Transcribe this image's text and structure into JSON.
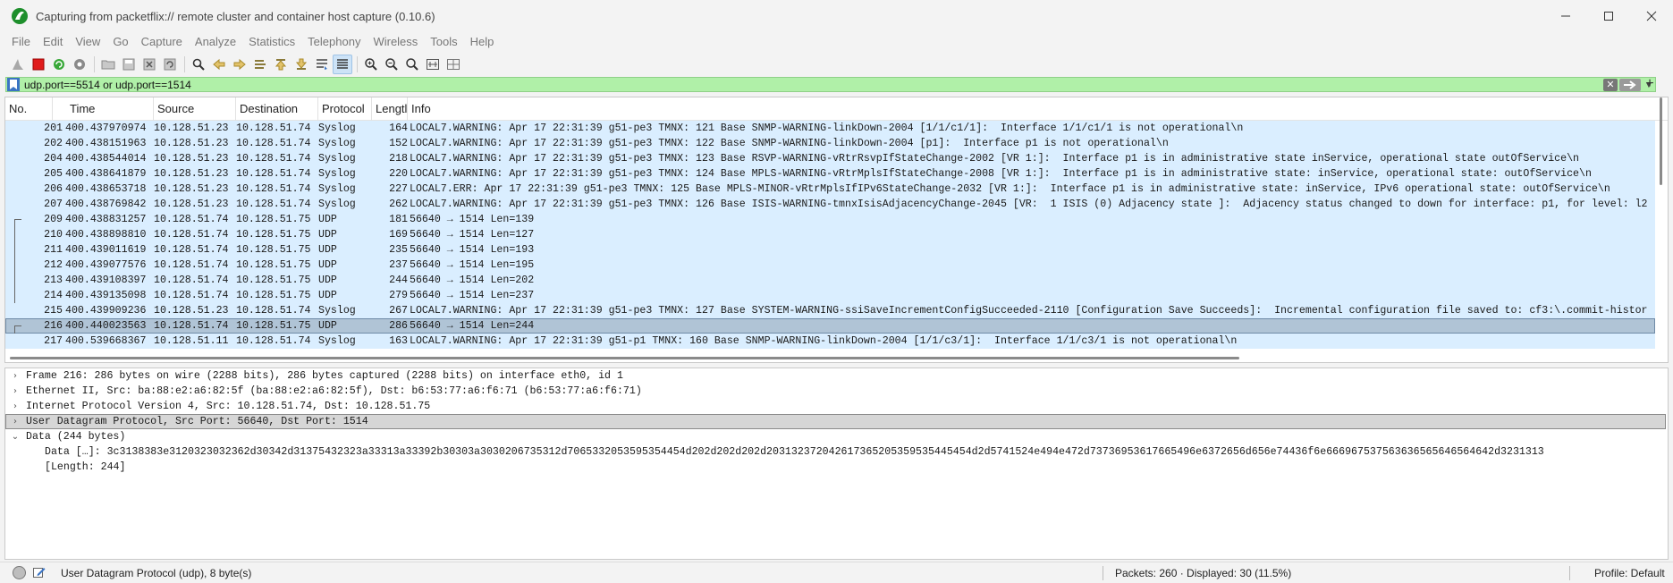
{
  "window": {
    "title": "Capturing from packetflix:// remote cluster and container host capture (0.10.6)",
    "minimize_icon": "minimize-icon",
    "maximize_icon": "maximize-icon",
    "close_icon": "close-icon"
  },
  "menu": [
    "File",
    "Edit",
    "View",
    "Go",
    "Capture",
    "Analyze",
    "Statistics",
    "Telephony",
    "Wireless",
    "Tools",
    "Help"
  ],
  "toolbar": {
    "icons": [
      "shark-fin-start-icon",
      "stop-capture-icon",
      "restart-capture-icon",
      "capture-options-icon",
      "open-file-icon",
      "save-file-icon",
      "close-file-icon",
      "reload-file-icon",
      "find-packet-icon",
      "go-back-icon",
      "go-forward-icon",
      "go-to-packet-icon",
      "go-first-packet-icon",
      "go-last-packet-icon",
      "auto-scroll-icon",
      "colorize-icon",
      "zoom-in-icon",
      "zoom-out-icon",
      "normal-size-icon",
      "resize-columns-icon",
      "layout-icon"
    ]
  },
  "filter": {
    "value": "udp.port==5514 or udp.port==1514",
    "clear_label": "✕",
    "add_label": "+",
    "accent_color": "#b0f0a8"
  },
  "packet_list": {
    "columns": [
      "No.",
      "Time",
      "Source",
      "Destination",
      "Protocol",
      "Lengtl",
      "Info"
    ],
    "rows": [
      {
        "no": "201",
        "time": "400.437970974",
        "src": "10.128.51.23",
        "dst": "10.128.51.74",
        "proto": "Syslog",
        "len": "164",
        "info": "LOCAL7.WARNING: Apr 17 22:31:39 g51-pe3 TMNX: 121 Base SNMP-WARNING-linkDown-2004 [1/1/c1/1]:  Interface 1/1/c1/1 is not operational\\n"
      },
      {
        "no": "202",
        "time": "400.438151963",
        "src": "10.128.51.23",
        "dst": "10.128.51.74",
        "proto": "Syslog",
        "len": "152",
        "info": "LOCAL7.WARNING: Apr 17 22:31:39 g51-pe3 TMNX: 122 Base SNMP-WARNING-linkDown-2004 [p1]:  Interface p1 is not operational\\n"
      },
      {
        "no": "204",
        "time": "400.438544014",
        "src": "10.128.51.23",
        "dst": "10.128.51.74",
        "proto": "Syslog",
        "len": "218",
        "info": "LOCAL7.WARNING: Apr 17 22:31:39 g51-pe3 TMNX: 123 Base RSVP-WARNING-vRtrRsvpIfStateChange-2002 [VR 1:]:  Interface p1 is in administrative state inService, operational state outOfService\\n"
      },
      {
        "no": "205",
        "time": "400.438641879",
        "src": "10.128.51.23",
        "dst": "10.128.51.74",
        "proto": "Syslog",
        "len": "220",
        "info": "LOCAL7.WARNING: Apr 17 22:31:39 g51-pe3 TMNX: 124 Base MPLS-WARNING-vRtrMplsIfStateChange-2008 [VR 1:]:  Interface p1 is in administrative state: inService, operational state: outOfService\\n"
      },
      {
        "no": "206",
        "time": "400.438653718",
        "src": "10.128.51.23",
        "dst": "10.128.51.74",
        "proto": "Syslog",
        "len": "227",
        "info": "LOCAL7.ERR: Apr 17 22:31:39 g51-pe3 TMNX: 125 Base MPLS-MINOR-vRtrMplsIfIPv6StateChange-2032 [VR 1:]:  Interface p1 is in administrative state: inService, IPv6 operational state: outOfService\\n"
      },
      {
        "no": "207",
        "time": "400.438769842",
        "src": "10.128.51.23",
        "dst": "10.128.51.74",
        "proto": "Syslog",
        "len": "262",
        "info": "LOCAL7.WARNING: Apr 17 22:31:39 g51-pe3 TMNX: 126 Base ISIS-WARNING-tmnxIsisAdjacencyChange-2045 [VR:  1 ISIS (0) Adjacency state ]:  Adjacency status changed to down for interface: p1, for level: l2"
      },
      {
        "no": "209",
        "time": "400.438831257",
        "src": "10.128.51.74",
        "dst": "10.128.51.75",
        "proto": "UDP",
        "len": "181",
        "info": "56640 → 1514 Len=139"
      },
      {
        "no": "210",
        "time": "400.438898810",
        "src": "10.128.51.74",
        "dst": "10.128.51.75",
        "proto": "UDP",
        "len": "169",
        "info": "56640 → 1514 Len=127"
      },
      {
        "no": "211",
        "time": "400.439011619",
        "src": "10.128.51.74",
        "dst": "10.128.51.75",
        "proto": "UDP",
        "len": "235",
        "info": "56640 → 1514 Len=193"
      },
      {
        "no": "212",
        "time": "400.439077576",
        "src": "10.128.51.74",
        "dst": "10.128.51.75",
        "proto": "UDP",
        "len": "237",
        "info": "56640 → 1514 Len=195"
      },
      {
        "no": "213",
        "time": "400.439108397",
        "src": "10.128.51.74",
        "dst": "10.128.51.75",
        "proto": "UDP",
        "len": "244",
        "info": "56640 → 1514 Len=202"
      },
      {
        "no": "214",
        "time": "400.439135098",
        "src": "10.128.51.74",
        "dst": "10.128.51.75",
        "proto": "UDP",
        "len": "279",
        "info": "56640 → 1514 Len=237"
      },
      {
        "no": "215",
        "time": "400.439909236",
        "src": "10.128.51.23",
        "dst": "10.128.51.74",
        "proto": "Syslog",
        "len": "267",
        "info": "LOCAL7.WARNING: Apr 17 22:31:39 g51-pe3 TMNX: 127 Base SYSTEM-WARNING-ssiSaveIncrementConfigSucceeded-2110 [Configuration Save Succeeds]:  Incremental configuration file saved to: cf3:\\.commit-histor"
      },
      {
        "no": "216",
        "time": "400.440023563",
        "src": "10.128.51.74",
        "dst": "10.128.51.75",
        "proto": "UDP",
        "len": "286",
        "info": "56640 → 1514 Len=244",
        "selected": true
      },
      {
        "no": "217",
        "time": "400.539668367",
        "src": "10.128.51.11",
        "dst": "10.128.51.74",
        "proto": "Syslog",
        "len": "163",
        "info": "LOCAL7.WARNING: Apr 17 22:31:39 g51-p1 TMNX: 160 Base SNMP-WARNING-linkDown-2004 [1/1/c3/1]:  Interface 1/1/c3/1 is not operational\\n"
      }
    ],
    "row_color": "#daeeff",
    "selected_row_color": "#b0c4d6"
  },
  "packet_details": [
    {
      "text": "Frame 216: 286 bytes on wire (2288 bits), 286 bytes captured (2288 bits) on interface eth0, id 1",
      "expander": "›",
      "level": 1
    },
    {
      "text": "Ethernet II, Src: ba:88:e2:a6:82:5f (ba:88:e2:a6:82:5f), Dst: b6:53:77:a6:f6:71 (b6:53:77:a6:f6:71)",
      "expander": "›",
      "level": 1
    },
    {
      "text": "Internet Protocol Version 4, Src: 10.128.51.74, Dst: 10.128.51.75",
      "expander": "›",
      "level": 1
    },
    {
      "text": "User Datagram Protocol, Src Port: 56640, Dst Port: 1514",
      "expander": "›",
      "level": 1,
      "selected": true
    },
    {
      "text": "Data (244 bytes)",
      "expander": "⌄",
      "level": 1
    },
    {
      "text": "Data […]: 3c3138383e3120323032362d30342d31375432323a33313a33392b30303a3030206735312d7065332053595354454d202d202d202d203132372042617365205359535445454d2d5741524e494e472d73736953617665496e6372656d656e74436f6e666967537563636565646564642d3231313",
      "expander": "",
      "level": 2
    },
    {
      "text": "[Length: 244]",
      "expander": "",
      "level": 2
    }
  ],
  "status": {
    "text": "User Datagram Protocol (udp), 8 byte(s)",
    "packets": "Packets: 260 · Displayed: 30 (11.5%)",
    "profile": "Profile: Default"
  }
}
